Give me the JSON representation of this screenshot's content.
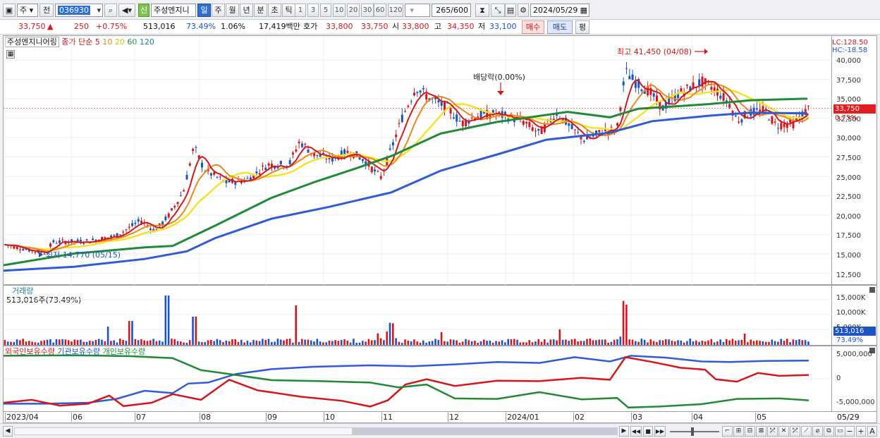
{
  "toolbar": {
    "period_select": "주",
    "prev_label": "전",
    "code": "036930",
    "credit_badge": "신",
    "stock_name": "주성엔지니",
    "period_tabs": [
      "일",
      "주",
      "월",
      "년",
      "분",
      "초",
      "틱"
    ],
    "active_period": "일",
    "interval_buttons": [
      "1",
      "3",
      "5",
      "10",
      "20",
      "30",
      "60",
      "120"
    ],
    "count": "265",
    "count_total": "/600",
    "date": "2024/05/29"
  },
  "quote": {
    "price": "33,750",
    "change_arrow": "▲",
    "change": "250",
    "change_pct": "+0.75%",
    "volume": "513,016",
    "volume_pct": "73.49%",
    "turnover_pct": "1.06%",
    "amount": "17,419백만",
    "label_hoga": "호가",
    "hoga_ask": "33,800",
    "hoga_bid": "33,750",
    "label_open": "시",
    "open": "33,800",
    "label_high": "고",
    "high": "34,350",
    "label_low": "저",
    "low": "33,100",
    "buy_label": "매수",
    "sell_label": "매도",
    "eval_label": "평"
  },
  "price_panel": {
    "stock_label": "주성엔지니어링",
    "ma_label": "종가 단순",
    "ma_periods": [
      "5",
      "10",
      "20",
      "60",
      "120"
    ],
    "lc_label": "LC:128.50",
    "hc_label": "HC:-18.58",
    "current_price_tag": "33,750",
    "current_change_tag": "0.75%",
    "high_annotation": "최고 41,450 (04/08)",
    "low_annotation": "최저 14,770 (05/15)",
    "dividend_annotation": "배당락(0.00%)",
    "y_ticks": [
      "40,000",
      "37,500",
      "35,000",
      "32,500",
      "30,000",
      "27,500",
      "25,000",
      "22,500",
      "20,000",
      "17,500",
      "15,000",
      "12,500"
    ]
  },
  "volume_panel": {
    "title": "거래량",
    "value_label": "513,016주(73.49%)",
    "y_ticks": [
      "15,000K",
      "10,000K",
      "5,000K"
    ],
    "current_tag": "513,016",
    "current_pct_tag": "73.49%"
  },
  "holdings_panel": {
    "series_labels": [
      "외국인보유수량",
      "기관보유수량",
      "개인보유수량"
    ],
    "y_ticks": [
      "5,000,000",
      "0",
      "-5,000,000"
    ]
  },
  "x_axis": {
    "ticks": [
      "2023/04",
      "06",
      "07",
      "08",
      "09",
      "10",
      "11",
      "12",
      "2024/01",
      "02",
      "03",
      "04",
      "05"
    ],
    "last_date": "05/29"
  },
  "colors": {
    "ma5": "#d4171b",
    "ma10": "#e8891c",
    "ma20": "#f5e22a",
    "ma60": "#1f8b3a",
    "ma120": "#2f5bd6",
    "up": "#d4171b",
    "down": "#1c54c4",
    "foreign": "#d4171b",
    "institution": "#2f5bd6",
    "individual": "#1f8b3a"
  }
}
